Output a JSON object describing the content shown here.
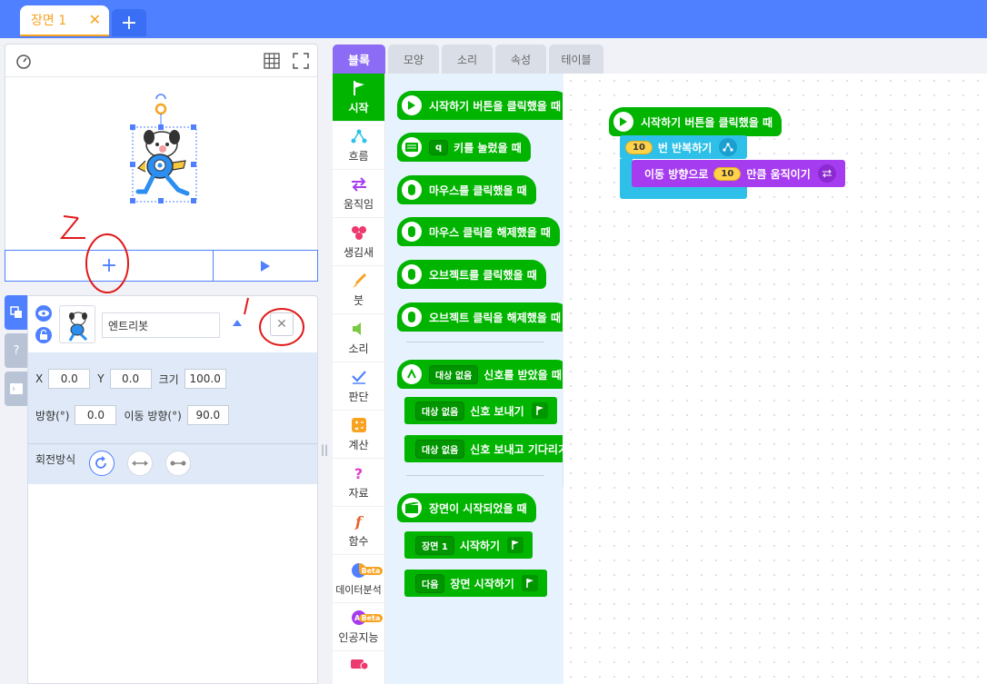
{
  "scene": {
    "tab_label": "장면 1",
    "close": "✕",
    "add": "+"
  },
  "object": {
    "name": "엔트리봇",
    "x_label": "X",
    "x": "0.0",
    "y_label": "Y",
    "y": "0.0",
    "size_label": "크기",
    "size": "100.0",
    "dir_label": "방향(°)",
    "dir": "0.0",
    "move_dir_label": "이동 방향(°)",
    "move_dir": "90.0",
    "rotation_label": "회전방식"
  },
  "annotations": {
    "mark_1": "1",
    "mark_2": "2"
  },
  "stage": {
    "add_object": "+"
  },
  "block_tabs": [
    "블록",
    "모양",
    "소리",
    "속성",
    "테이블"
  ],
  "categories": [
    "시작",
    "흐름",
    "움직임",
    "생김새",
    "붓",
    "소리",
    "판단",
    "계산",
    "자료",
    "함수",
    "데이터분석",
    "인공지능"
  ],
  "beta": "Beta",
  "palette": {
    "b1": "시작하기 버튼을 클릭했을 때",
    "b2_key": "q",
    "b2": "키를 눌렀을 때",
    "b3": "마우스를 클릭했을 때",
    "b4": "마우스 클릭을 해제했을 때",
    "b5": "오브젝트를 클릭했을 때",
    "b6": "오브젝트 클릭을 해제했을 때",
    "b7_target": "대상 없음",
    "b7": "신호를 받았을 때",
    "b8_target": "대상 없음",
    "b8": "신호 보내기",
    "b9_target": "대상 없음",
    "b9": "신호 보내고 기다리기",
    "b10": "장면이 시작되었을 때",
    "b11_target": "장면 1",
    "b11": "시작하기",
    "b12_target": "다음",
    "b12": "장면 시작하기"
  },
  "workspace": {
    "start": "시작하기 버튼을 클릭했을 때",
    "repeat_num": "10",
    "repeat": "번 반복하기",
    "move_prefix": "이동 방향으로",
    "move_num": "10",
    "move_suffix": "만큼 움직이기"
  },
  "colors": {
    "accent": "#4f80ff",
    "start": "#00b400",
    "flow": "#2ec0e8",
    "motion": "#a63cf0",
    "annotation": "#e01a1a"
  }
}
